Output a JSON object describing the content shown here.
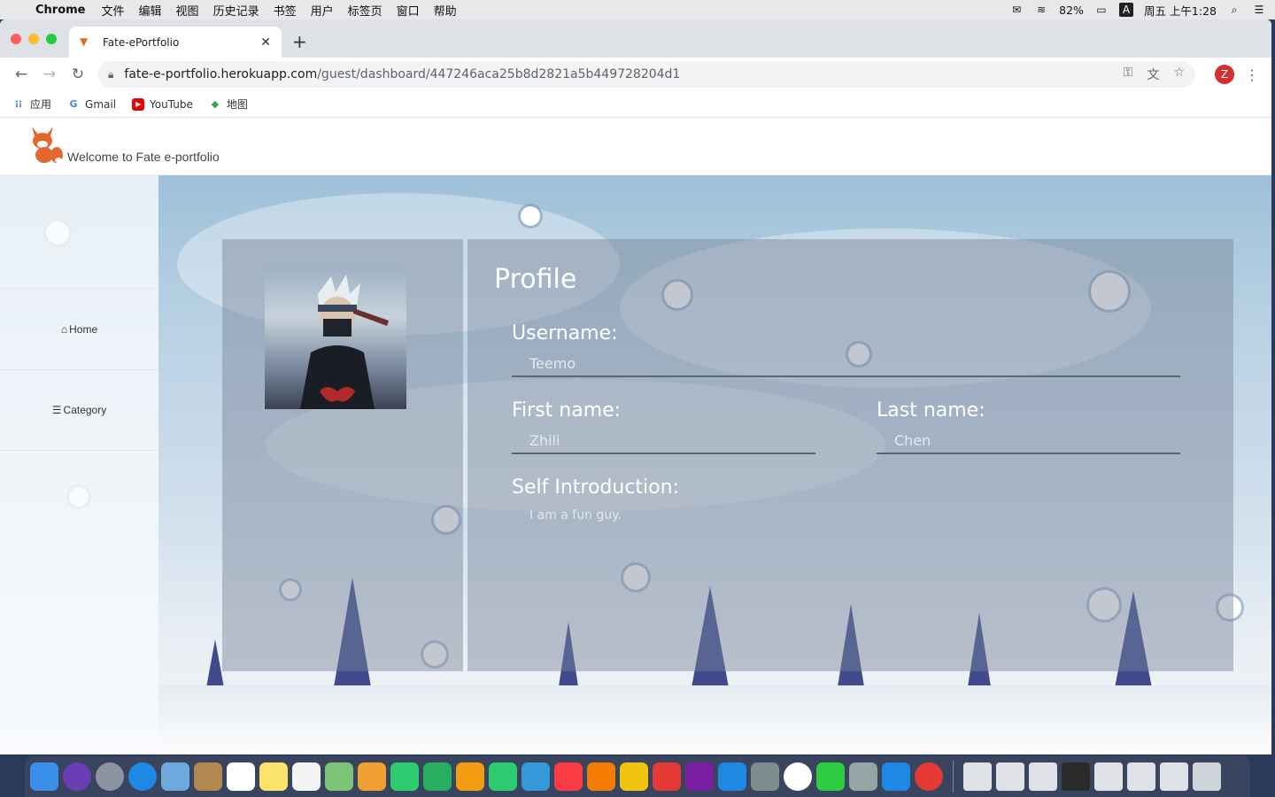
{
  "menubar": {
    "app_name": "Chrome",
    "menus": [
      "文件",
      "编辑",
      "视图",
      "历史记录",
      "书签",
      "用户",
      "标签页",
      "窗口",
      "帮助"
    ],
    "battery": "82%",
    "input_method": "A",
    "clock": "周五 上午1:28"
  },
  "browser": {
    "tab_title": "Fate-ePortfolio",
    "url_host": "fate-e-portfolio.herokuapp.com",
    "url_path": "/guest/dashboard/447246aca25b8d2821a5b449728204d1",
    "profile_initial": "Z",
    "bookmarks": [
      "应用",
      "Gmail",
      "YouTube",
      "地图"
    ]
  },
  "site": {
    "title": "Welcome to Fate e-portfolio"
  },
  "sidebar": {
    "items": [
      {
        "label": "Home",
        "icon": "home-icon"
      },
      {
        "label": "Category",
        "icon": "menu-icon"
      }
    ]
  },
  "profile": {
    "heading": "Profile",
    "username_label": "Username:",
    "username_value": "Teemo",
    "first_name_label": "First name:",
    "first_name_value": "Zhili",
    "last_name_label": "Last name:",
    "last_name_value": "Chen",
    "intro_label": "Self Introduction:",
    "intro_value": "I am a fun guy."
  }
}
